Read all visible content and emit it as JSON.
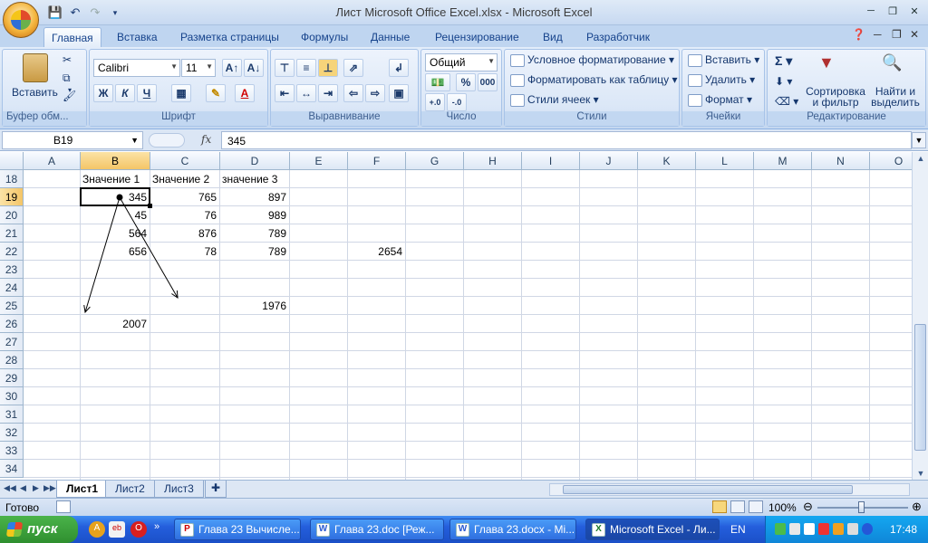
{
  "window": {
    "title": "Лист Microsoft Office Excel.xlsx - Microsoft Excel"
  },
  "ribbon": {
    "tabs": [
      "Главная",
      "Вставка",
      "Разметка страницы",
      "Формулы",
      "Данные",
      "Рецензирование",
      "Вид",
      "Разработчик"
    ],
    "groups": {
      "clipboard": {
        "label": "Буфер обм...",
        "paste": "Вставить"
      },
      "font": {
        "label": "Шрифт",
        "font_name": "Calibri",
        "font_size": "11",
        "bold": "Ж",
        "italic": "К",
        "underline": "Ч"
      },
      "alignment": {
        "label": "Выравнивание"
      },
      "number": {
        "label": "Число",
        "format": "Общий",
        "percent": "%",
        "thousands": "000"
      },
      "styles": {
        "label": "Стили",
        "conditional": "Условное форматирование",
        "as_table": "Форматировать как таблицу",
        "cell_styles": "Стили ячеек"
      },
      "cells": {
        "label": "Ячейки",
        "insert": "Вставить",
        "delete": "Удалить",
        "format": "Формат"
      },
      "editing": {
        "label": "Редактирование",
        "sort": "Сортировка и фильтр",
        "find": "Найти и выделить"
      }
    }
  },
  "formula_bar": {
    "name_box": "B19",
    "fx": "fx",
    "value": "345"
  },
  "grid": {
    "columns": [
      "A",
      "B",
      "C",
      "D",
      "E",
      "F",
      "G",
      "H",
      "I",
      "J",
      "K",
      "L",
      "M",
      "N",
      "O"
    ],
    "rows": [
      "18",
      "19",
      "20",
      "21",
      "22",
      "23",
      "24",
      "25",
      "26",
      "27",
      "28",
      "29",
      "30",
      "31",
      "32",
      "33",
      "34"
    ],
    "selected_column": "B",
    "selected_row": "19",
    "cells": {
      "B18": "Значение 1",
      "C18": "Значение 2",
      "D18": "значение 3",
      "B19": "345",
      "C19": "765",
      "D19": "897",
      "B20": "45",
      "C20": "76",
      "D20": "989",
      "B21": "564",
      "C21": "876",
      "D21": "789",
      "B22": "656",
      "C22": "78",
      "D22": "789",
      "F22": "2654",
      "D25": "1976",
      "B26": "2007"
    }
  },
  "sheets": {
    "tabs": [
      "Лист1",
      "Лист2",
      "Лист3"
    ],
    "active": "Лист1"
  },
  "status": {
    "ready": "Готово",
    "zoom": "100%"
  },
  "taskbar": {
    "start": "пуск",
    "tasks": [
      "Глава 23 Вычисле...",
      "Глава 23.doc [Реж...",
      "Глава 23.docx - Mi...",
      "Microsoft Excel - Ли..."
    ],
    "lang": "EN",
    "clock": "17:48"
  }
}
